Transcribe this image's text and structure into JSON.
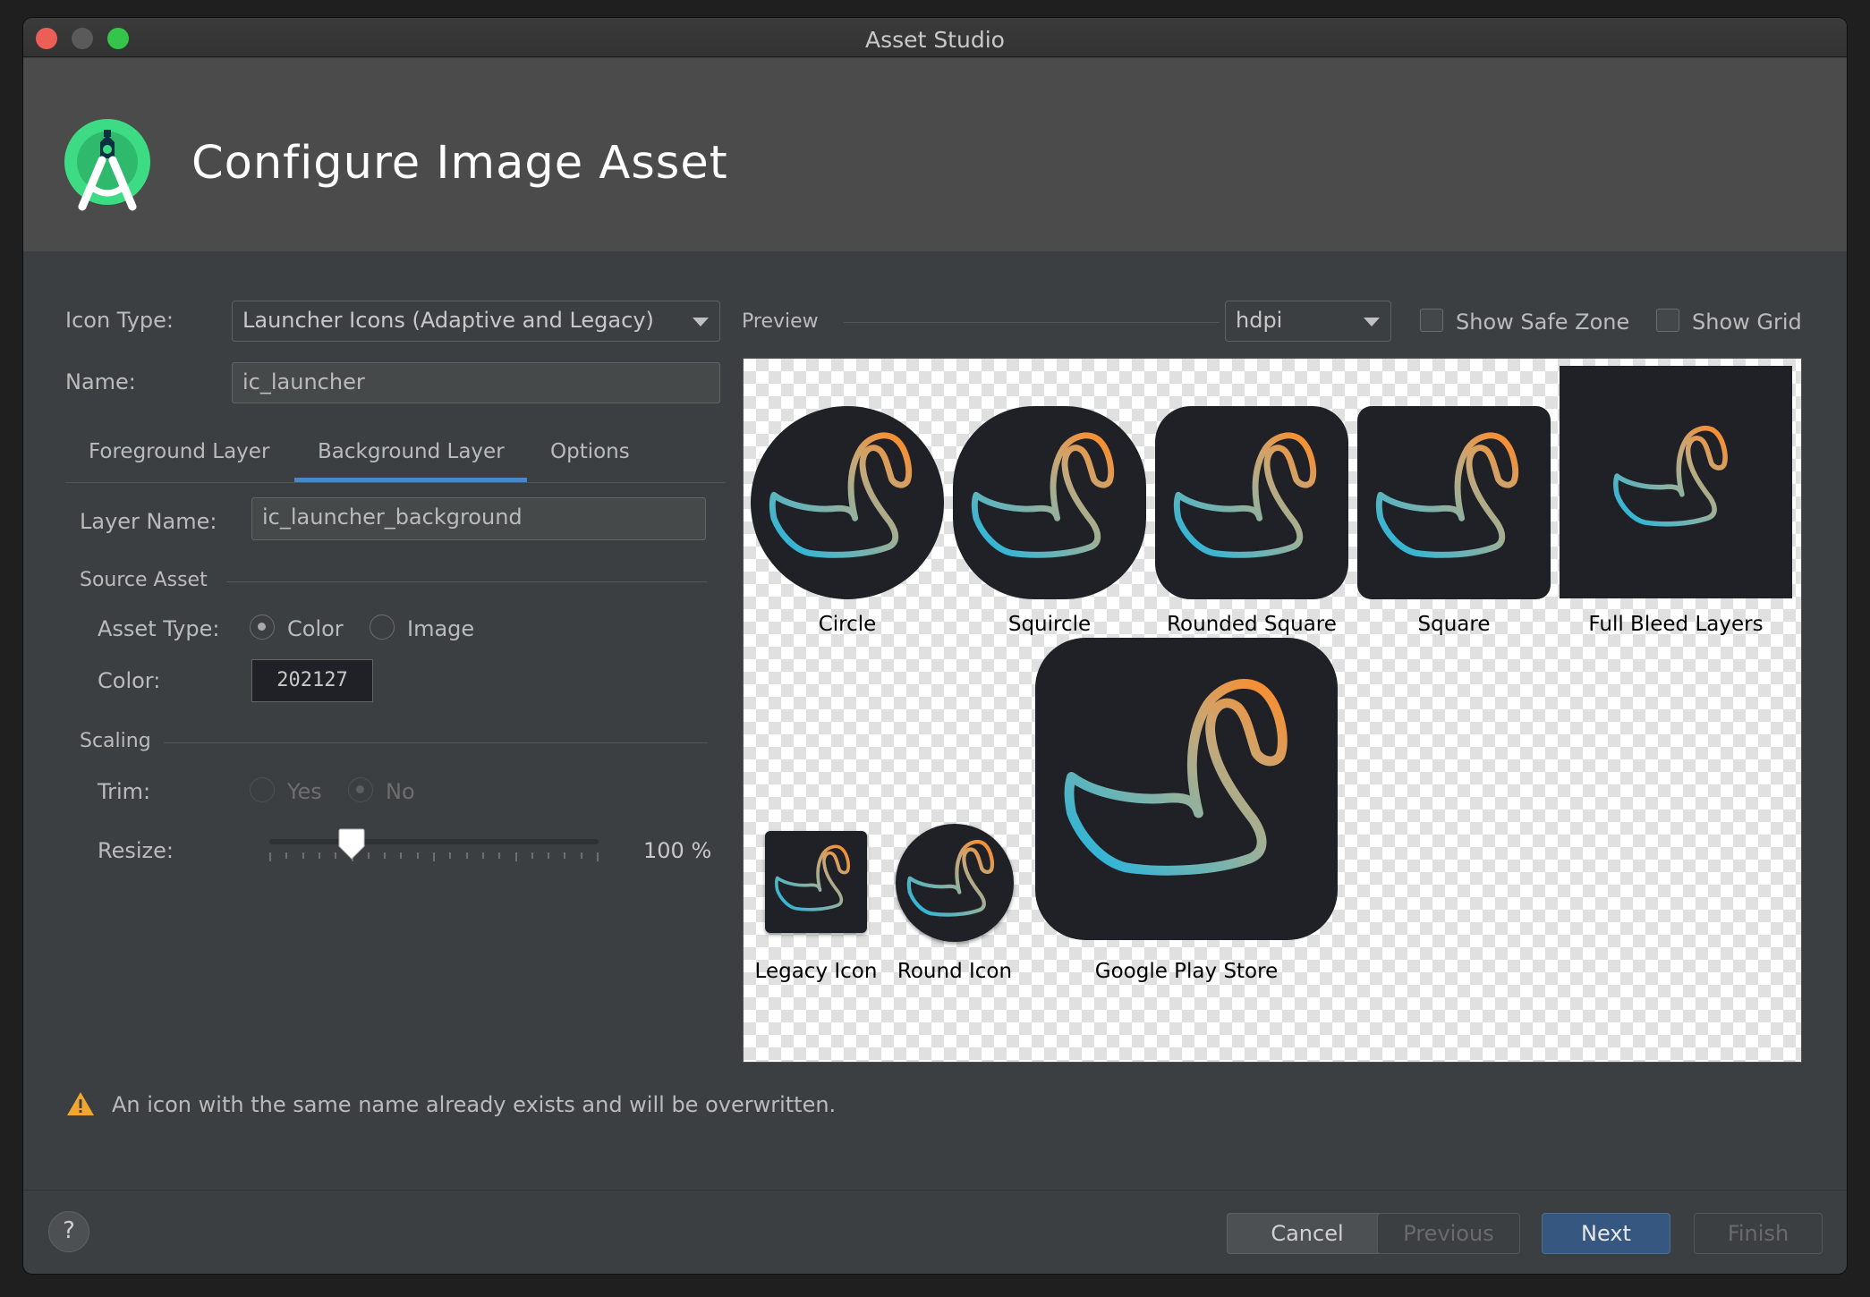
{
  "window": {
    "title": "Asset Studio"
  },
  "header": {
    "title": "Configure Image Asset",
    "logo_icon": "android-studio-logo-icon"
  },
  "form": {
    "icon_type_label": "Icon Type:",
    "icon_type_value": "Launcher Icons (Adaptive and Legacy)",
    "name_label": "Name:",
    "name_value": "ic_launcher"
  },
  "tabs": [
    {
      "label": "Foreground Layer",
      "selected": false
    },
    {
      "label": "Background Layer",
      "selected": true
    },
    {
      "label": "Options",
      "selected": false
    }
  ],
  "layer": {
    "layer_name_label": "Layer Name:",
    "layer_name_value": "ic_launcher_background",
    "source_asset_heading": "Source Asset",
    "asset_type_label": "Asset Type:",
    "asset_type_options": [
      "Color",
      "Image"
    ],
    "asset_type_selected": "Color",
    "color_label": "Color:",
    "color_value": "202127",
    "scaling_heading": "Scaling",
    "trim_label": "Trim:",
    "trim_options": [
      "Yes",
      "No"
    ],
    "trim_selected": "No",
    "resize_label": "Resize:",
    "resize_value_text": "100 %",
    "resize_slider_fraction": 0.25
  },
  "preview": {
    "label": "Preview",
    "density_value": "hdpi",
    "show_safe_zone_label": "Show Safe Zone",
    "show_safe_zone_checked": false,
    "show_grid_label": "Show Grid",
    "show_grid_checked": false,
    "icons": [
      "Circle",
      "Squircle",
      "Rounded Square",
      "Square",
      "Full Bleed Layers",
      "Legacy Icon",
      "Round Icon",
      "Google Play Store"
    ],
    "icon_background_color": "#202127"
  },
  "warning": {
    "text": "An icon with the same name already exists and will be overwritten.",
    "icon": "warning-icon"
  },
  "buttons": {
    "help": "?",
    "cancel": "Cancel",
    "previous": "Previous",
    "next": "Next",
    "finish": "Finish"
  },
  "colors": {
    "accent": "#4a88c7",
    "primary_button": "#365880",
    "warning": "#f0a732",
    "swan_start": "#1fb6e0",
    "swan_end": "#ff8f2e"
  }
}
